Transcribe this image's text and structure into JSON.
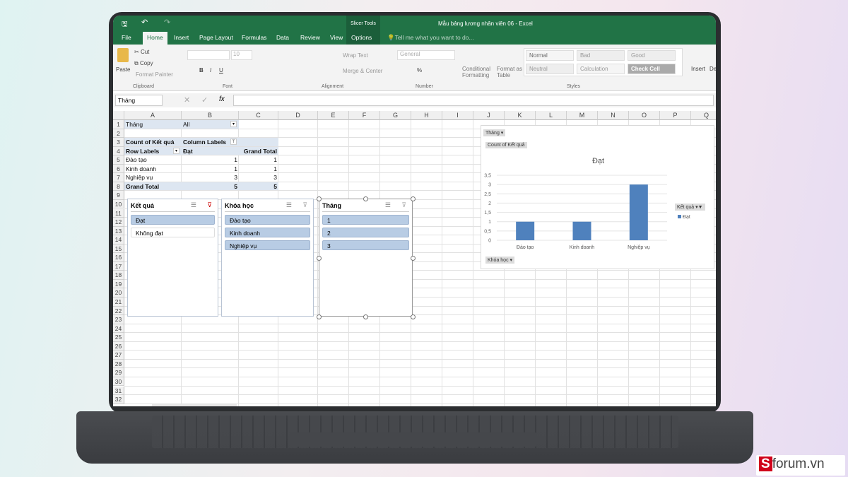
{
  "window": {
    "title": "Mẫu bảng lương nhân viên 06 - Excel",
    "contextual": "Slicer Tools",
    "undo_icon": "undo-icon",
    "redo_icon": "redo-icon",
    "save_icon": "save-icon"
  },
  "tabs": [
    "File",
    "Home",
    "Insert",
    "Page Layout",
    "Formulas",
    "Data",
    "Review",
    "View",
    "Options"
  ],
  "tell_me": "Tell me what you want to do...",
  "ribbon": {
    "clipboard": {
      "paste": "Paste",
      "cut": "Cut",
      "copy": "Copy",
      "format_painter": "Format Painter",
      "label": "Clipboard"
    },
    "font": {
      "size": "10",
      "label": "Font",
      "bold": "B",
      "italic": "I",
      "underline": "U"
    },
    "alignment": {
      "wrap": "Wrap Text",
      "merge": "Merge & Center",
      "label": "Alignment"
    },
    "number": {
      "format": "General",
      "label": "Number",
      "percent": "%"
    },
    "styles": {
      "conditional": "Conditional Formatting",
      "format_table": "Format as Table",
      "items": [
        "Normal",
        "Bad",
        "Good",
        "Neutral",
        "Calculation",
        "Check Cell"
      ],
      "label": "Styles"
    },
    "cells": {
      "insert": "Insert",
      "delete": "De"
    }
  },
  "formula_bar": {
    "name_box": "Tháng",
    "fx": "fx",
    "value": ""
  },
  "columns": [
    "A",
    "B",
    "C",
    "D",
    "E",
    "F",
    "G",
    "H",
    "I",
    "J",
    "K",
    "L",
    "M",
    "N",
    "O",
    "P",
    "Q"
  ],
  "rows": [
    "1",
    "2",
    "3",
    "4",
    "5",
    "6",
    "7",
    "8",
    "9",
    "10",
    "11",
    "12",
    "13",
    "14",
    "15",
    "16",
    "17",
    "18",
    "19",
    "20",
    "21",
    "22",
    "23",
    "24",
    "25",
    "26",
    "27",
    "28",
    "29",
    "30",
    "31",
    "32"
  ],
  "pivot": {
    "filter_label": "Tháng",
    "filter_value": "All",
    "value_label": "Count of Kết quả",
    "column_labels": "Column Labels",
    "row_labels": "Row Labels",
    "col_header": "Đạt",
    "grand_total": "Grand Total",
    "rows": [
      {
        "label": "Đào tạo",
        "dat": "1",
        "total": "1"
      },
      {
        "label": "Kinh doanh",
        "dat": "1",
        "total": "1"
      },
      {
        "label": "Nghiệp vụ",
        "dat": "3",
        "total": "3"
      }
    ],
    "total_row": {
      "label": "Grand Total",
      "dat": "5",
      "total": "5"
    }
  },
  "slicers": [
    {
      "title": "Kết quả",
      "items": [
        {
          "label": "Đạt",
          "selected": true
        },
        {
          "label": "Không đạt",
          "selected": false
        }
      ]
    },
    {
      "title": "Khóa học",
      "items": [
        {
          "label": "Đào tạo",
          "selected": true
        },
        {
          "label": "Kinh doanh",
          "selected": true
        },
        {
          "label": "Nghiệp vụ",
          "selected": true
        }
      ]
    },
    {
      "title": "Tháng",
      "items": [
        {
          "label": "1",
          "selected": true
        },
        {
          "label": "2",
          "selected": true
        },
        {
          "label": "3",
          "selected": true
        }
      ]
    }
  ],
  "chart_data": {
    "type": "bar",
    "title": "Đạt",
    "categories": [
      "Đào tạo",
      "Kinh doanh",
      "Nghiệp vụ"
    ],
    "series": [
      {
        "name": "Đạt",
        "values": [
          1,
          1,
          3
        ]
      }
    ],
    "ylim": [
      0,
      3.5
    ],
    "yticks": [
      "0",
      "0,5",
      "1",
      "1,5",
      "2",
      "2,5",
      "3",
      "3,5"
    ],
    "grid": true,
    "legend": "right",
    "legend_title": "Kết quả",
    "filter_button": "Tháng",
    "value_button": "Count of Kết quả",
    "axis_button": "Khóa học",
    "bar_color": "#4f81bd"
  },
  "brand": "forum.vn",
  "colors": {
    "excel_green": "#217346",
    "pivot_band": "#dde6f1",
    "slicer_selected": "#b8cce4"
  }
}
